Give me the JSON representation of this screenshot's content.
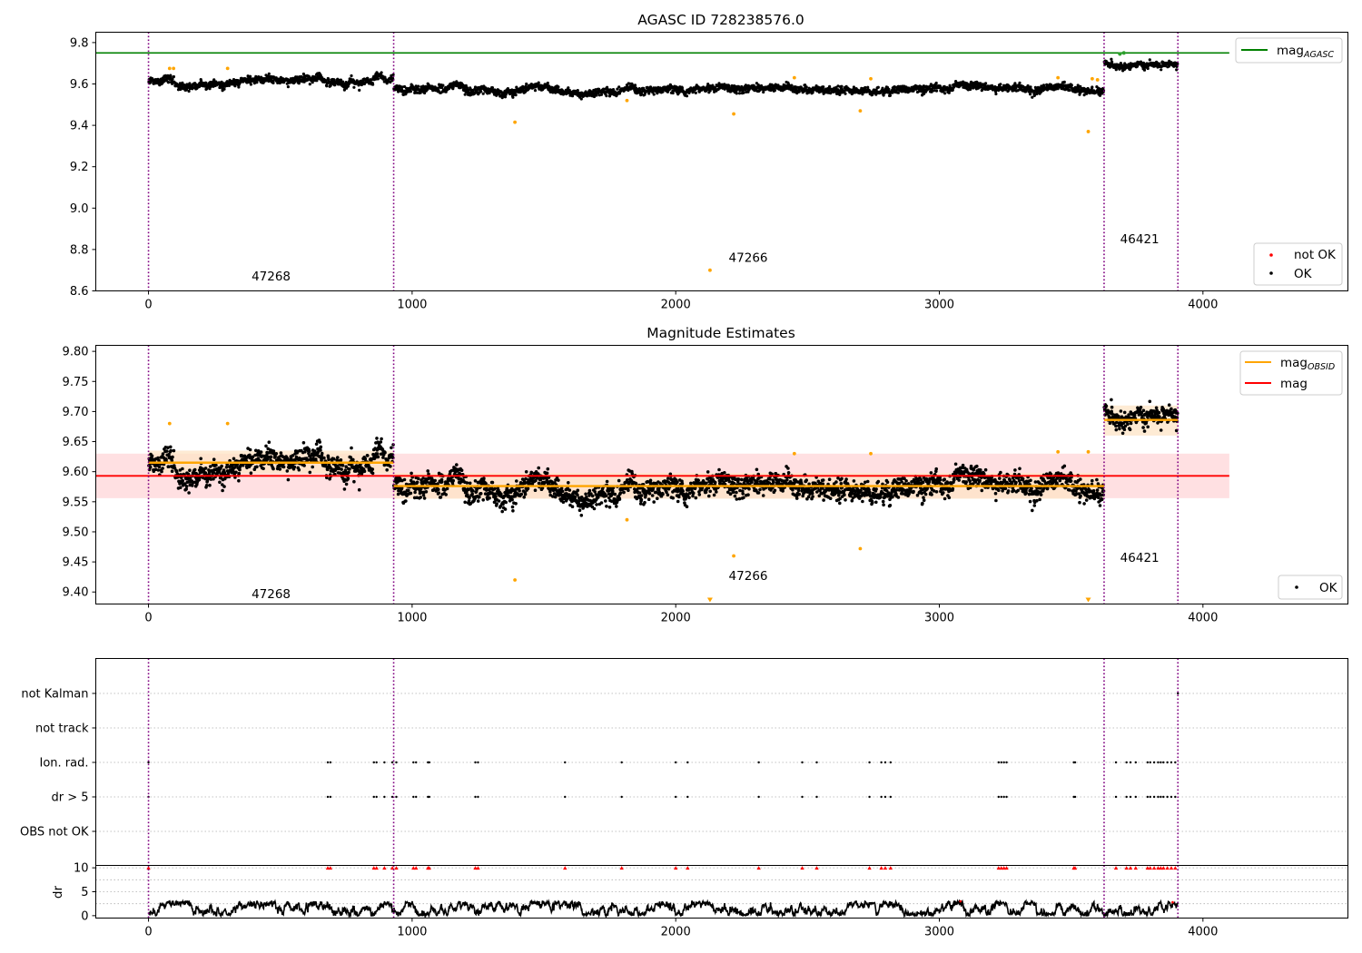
{
  "figure": {
    "background": "#ffffff"
  },
  "chart_data": [
    {
      "type": "scatter",
      "panel": "top",
      "title": "AGASC ID 728238576.0",
      "xlabel": "",
      "ylabel": "",
      "xlim": [
        -200,
        4550
      ],
      "ylim": [
        8.6,
        9.85
      ],
      "xticks": [
        0,
        1000,
        2000,
        3000,
        4000
      ],
      "yticks": [
        8.6,
        8.8,
        9.0,
        9.2,
        9.4,
        9.6,
        9.8
      ],
      "grid": false,
      "hlines": [
        {
          "name": "mag_AGASC",
          "y": 9.75,
          "x": [
            -200,
            4100
          ],
          "color": "#008000"
        }
      ],
      "vlines": {
        "x": [
          0,
          930,
          3625,
          3905
        ],
        "color": "#800080",
        "style": "dotted"
      },
      "obsid_labels": [
        {
          "text": "47268",
          "x": 465,
          "y": 8.65
        },
        {
          "text": "47266",
          "x": 2275,
          "y": 8.74
        },
        {
          "text": "46421",
          "x": 3760,
          "y": 8.83
        }
      ],
      "ok_series": {
        "name": "OK",
        "color": "#000000",
        "segments": [
          {
            "x": [
              0,
              930
            ],
            "level": 9.625,
            "start_level": 9.61,
            "spread": 0.016,
            "wave": 0.022
          },
          {
            "x": [
              930,
              3625
            ],
            "level": 9.578,
            "spread": 0.016,
            "wave": 0.015
          },
          {
            "x": [
              3625,
              3905
            ],
            "level": 9.69,
            "start_level": 9.72,
            "spread": 0.014,
            "wave": 0.015
          }
        ]
      },
      "orange_points": [
        {
          "x": 80,
          "y": 9.675
        },
        {
          "x": 95,
          "y": 9.675
        },
        {
          "x": 300,
          "y": 9.675
        },
        {
          "x": 1390,
          "y": 9.415
        },
        {
          "x": 1815,
          "y": 9.52
        },
        {
          "x": 2130,
          "y": 8.7
        },
        {
          "x": 2220,
          "y": 9.455
        },
        {
          "x": 2450,
          "y": 9.63
        },
        {
          "x": 2700,
          "y": 9.47
        },
        {
          "x": 2740,
          "y": 9.625
        },
        {
          "x": 3450,
          "y": 9.63
        },
        {
          "x": 3565,
          "y": 9.37
        },
        {
          "x": 3580,
          "y": 9.625
        },
        {
          "x": 3600,
          "y": 9.62
        }
      ],
      "green_points": [
        {
          "x": 3685,
          "y": 9.745
        },
        {
          "x": 3700,
          "y": 9.75
        }
      ],
      "legends": [
        {
          "loc": "upper right",
          "entries": [
            {
              "label_main": "mag",
              "label_sub": "AGASC",
              "marker": "line",
              "color": "#008000"
            }
          ]
        },
        {
          "loc": "lower right",
          "entries": [
            {
              "label": "not OK",
              "marker": "dot",
              "color": "#ff0000"
            },
            {
              "label": "OK",
              "marker": "dot",
              "color": "#000000"
            }
          ]
        }
      ]
    },
    {
      "type": "scatter",
      "panel": "middle",
      "title": "Magnitude Estimates",
      "xlabel": "",
      "ylabel": "",
      "xlim": [
        -200,
        4550
      ],
      "ylim": [
        9.38,
        9.81
      ],
      "xticks": [
        0,
        1000,
        2000,
        3000,
        4000
      ],
      "yticks": [
        9.4,
        9.45,
        9.5,
        9.55,
        9.6,
        9.65,
        9.7,
        9.75,
        9.8
      ],
      "ytick_labels": [
        "9.40",
        "9.45",
        "9.50",
        "9.55",
        "9.60",
        "9.65",
        "9.70",
        "9.75",
        "9.80"
      ],
      "grid": false,
      "mag": {
        "y": 9.593,
        "x": [
          -200,
          4100
        ],
        "band": [
          9.556,
          9.63
        ],
        "color": "#ff0000",
        "band_color": "#ffdadd"
      },
      "mag_obsid": [
        {
          "x": [
            0,
            930
          ],
          "y": 9.615,
          "band": [
            9.597,
            9.635
          ]
        },
        {
          "x": [
            930,
            3625
          ],
          "y": 9.576,
          "band": [
            9.555,
            9.598
          ]
        },
        {
          "x": [
            3625,
            3905
          ],
          "y": 9.686,
          "band": [
            9.66,
            9.71
          ]
        }
      ],
      "mag_obsid_color": "#ffa500",
      "mag_obsid_band_color": "#fde4c6",
      "vlines": {
        "x": [
          0,
          930,
          3625,
          3905
        ],
        "color": "#800080",
        "style": "dotted"
      },
      "obsid_labels": [
        {
          "text": "47268",
          "x": 465,
          "y": 9.39
        },
        {
          "text": "47266",
          "x": 2275,
          "y": 9.42
        },
        {
          "text": "46421",
          "x": 3760,
          "y": 9.45
        }
      ],
      "ok_series": {
        "name": "OK",
        "color": "#000000",
        "segments": [
          {
            "x": [
              0,
              930
            ],
            "level": 9.625,
            "start_level": 9.61,
            "spread": 0.016,
            "wave": 0.022
          },
          {
            "x": [
              930,
              3625
            ],
            "level": 9.578,
            "spread": 0.016,
            "wave": 0.015
          },
          {
            "x": [
              3625,
              3905
            ],
            "level": 9.69,
            "start_level": 9.72,
            "spread": 0.014,
            "wave": 0.015
          }
        ]
      },
      "orange_points": [
        {
          "x": 80,
          "y": 9.68
        },
        {
          "x": 300,
          "y": 9.68
        },
        {
          "x": 1390,
          "y": 9.42
        },
        {
          "x": 1815,
          "y": 9.52
        },
        {
          "x": 2220,
          "y": 9.46
        },
        {
          "x": 2450,
          "y": 9.63
        },
        {
          "x": 2700,
          "y": 9.472
        },
        {
          "x": 2740,
          "y": 9.63
        },
        {
          "x": 3450,
          "y": 9.633
        },
        {
          "x": 3565,
          "y": 9.633
        }
      ],
      "offscale_markers": [
        {
          "x": 2130
        },
        {
          "x": 3565
        }
      ],
      "legends": [
        {
          "loc": "upper right",
          "entries": [
            {
              "label_main": "mag",
              "label_sub": "OBSID",
              "marker": "line",
              "color": "#ffa500"
            },
            {
              "label": "mag",
              "marker": "line",
              "color": "#ff0000"
            }
          ]
        },
        {
          "loc": "lower right",
          "entries": [
            {
              "label": "OK",
              "marker": "dot",
              "color": "#000000"
            }
          ]
        }
      ]
    },
    {
      "type": "scatter",
      "panel": "flags",
      "xlim": [
        -200,
        4550
      ],
      "xticks": [
        0,
        1000,
        2000,
        3000,
        4000
      ],
      "categories": [
        "not Kalman",
        "not track",
        "Ion. rad.",
        "dr > 5",
        "OBS not OK"
      ],
      "grid": "horizontal dotted",
      "vlines": {
        "x": [
          0,
          930,
          3625,
          3905
        ],
        "color": "#800080",
        "style": "dotted"
      },
      "flag_x": [
        0,
        680,
        690,
        855,
        865,
        895,
        925,
        940,
        1005,
        1015,
        1060,
        1065,
        1240,
        1250,
        1580,
        1795,
        2000,
        2045,
        2315,
        2480,
        2535,
        2735,
        2780,
        2795,
        2815,
        3225,
        3235,
        3245,
        3255,
        3510,
        3515,
        3670,
        3710,
        3725,
        3745,
        3790,
        3800,
        3815,
        3830,
        3840,
        3850,
        3865,
        3880,
        3895
      ],
      "flag_rows": [
        "Ion. rad.",
        "dr > 5"
      ],
      "not_kalman_x": [
        3905
      ]
    },
    {
      "type": "line",
      "panel": "dr",
      "ylabel": "dr",
      "xlim": [
        -200,
        4550
      ],
      "ylim": [
        -0.5,
        10.5
      ],
      "xticks": [
        0,
        1000,
        2000,
        3000,
        4000
      ],
      "yticks": [
        0,
        5,
        10
      ],
      "grid": "horizontal dotted",
      "dr_range": [
        0,
        3
      ],
      "high_dr_x": [
        0,
        680,
        690,
        855,
        865,
        895,
        925,
        940,
        1005,
        1015,
        1060,
        1065,
        1240,
        1250,
        1580,
        1795,
        2000,
        2045,
        2315,
        2480,
        2535,
        2735,
        2780,
        2795,
        2815,
        3225,
        3235,
        3245,
        3255,
        3510,
        3515,
        3670,
        3710,
        3725,
        3745,
        3790,
        3800,
        3815,
        3830,
        3840,
        3850,
        3865,
        3880,
        3895
      ],
      "red_points": [
        {
          "x": 3080,
          "y": 3.0
        },
        {
          "x": 3885,
          "y": 2.8
        }
      ],
      "color": "#000000"
    }
  ]
}
